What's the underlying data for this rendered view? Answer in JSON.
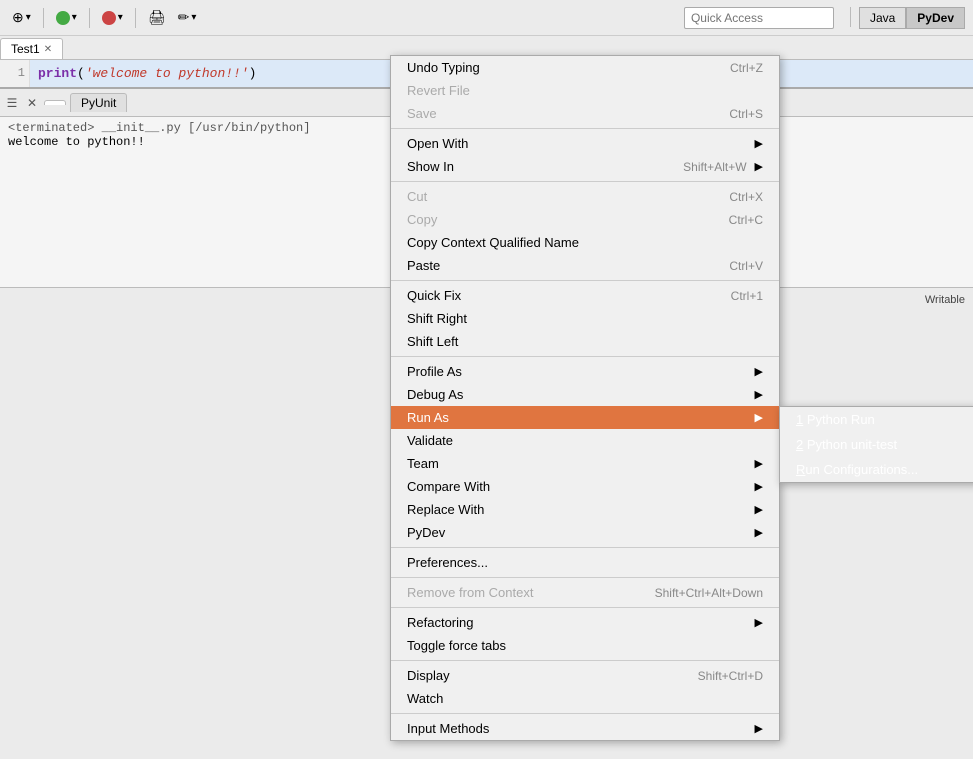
{
  "toolbar": {
    "quick_access_placeholder": "Quick Access",
    "java_label": "Java",
    "pydev_label": "PyDev"
  },
  "editor": {
    "tab_label": "Test1",
    "line1_number": "1",
    "line1_code_prefix": "print(",
    "line1_string": "'welcome to python!!'",
    "line1_code_suffix": ")"
  },
  "console": {
    "terminated_text": "<terminated> __init__.py [/usr/bin/python]",
    "output_text": "welcome to python!!",
    "tab_pyunit": "PyUnit"
  },
  "status_bar": {
    "writable": "Writable"
  },
  "context_menu": {
    "items": [
      {
        "label": "Undo Typing",
        "shortcut": "Ctrl+Z",
        "disabled": false,
        "has_arrow": false
      },
      {
        "label": "Revert File",
        "shortcut": "",
        "disabled": true,
        "has_arrow": false
      },
      {
        "label": "Save",
        "shortcut": "Ctrl+S",
        "disabled": true,
        "has_arrow": false
      },
      {
        "separator": true
      },
      {
        "label": "Open With",
        "shortcut": "",
        "disabled": false,
        "has_arrow": true
      },
      {
        "label": "Show In",
        "shortcut": "Shift+Alt+W",
        "disabled": false,
        "has_arrow": true
      },
      {
        "separator": true
      },
      {
        "label": "Cut",
        "shortcut": "Ctrl+X",
        "disabled": true,
        "has_arrow": false
      },
      {
        "label": "Copy",
        "shortcut": "Ctrl+C",
        "disabled": true,
        "has_arrow": false
      },
      {
        "label": "Copy Context Qualified Name",
        "shortcut": "",
        "disabled": false,
        "has_arrow": false
      },
      {
        "label": "Paste",
        "shortcut": "Ctrl+V",
        "disabled": false,
        "has_arrow": false
      },
      {
        "separator": true
      },
      {
        "label": "Quick Fix",
        "shortcut": "Ctrl+1",
        "disabled": false,
        "has_arrow": false
      },
      {
        "label": "Shift Right",
        "shortcut": "",
        "disabled": false,
        "has_arrow": false
      },
      {
        "label": "Shift Left",
        "shortcut": "",
        "disabled": false,
        "has_arrow": false
      },
      {
        "separator": true
      },
      {
        "label": "Profile As",
        "shortcut": "",
        "disabled": false,
        "has_arrow": true
      },
      {
        "label": "Debug As",
        "shortcut": "",
        "disabled": false,
        "has_arrow": true
      },
      {
        "label": "Run As",
        "shortcut": "",
        "disabled": false,
        "has_arrow": true,
        "highlighted": true
      },
      {
        "label": "Validate",
        "shortcut": "",
        "disabled": false,
        "has_arrow": false
      },
      {
        "label": "Team",
        "shortcut": "",
        "disabled": false,
        "has_arrow": true
      },
      {
        "label": "Compare With",
        "shortcut": "",
        "disabled": false,
        "has_arrow": true
      },
      {
        "label": "Replace With",
        "shortcut": "",
        "disabled": false,
        "has_arrow": true
      },
      {
        "label": "PyDev",
        "shortcut": "",
        "disabled": false,
        "has_arrow": true
      },
      {
        "separator": true
      },
      {
        "label": "Preferences...",
        "shortcut": "",
        "disabled": false,
        "has_arrow": false
      },
      {
        "separator": true
      },
      {
        "label": "Remove from Context",
        "shortcut": "Shift+Ctrl+Alt+Down",
        "disabled": true,
        "has_arrow": false
      },
      {
        "separator": true
      },
      {
        "label": "Refactoring",
        "shortcut": "",
        "disabled": false,
        "has_arrow": true
      },
      {
        "label": "Toggle force tabs",
        "shortcut": "",
        "disabled": false,
        "has_arrow": false
      },
      {
        "separator": true
      },
      {
        "label": "Display",
        "shortcut": "Shift+Ctrl+D",
        "disabled": false,
        "has_arrow": false
      },
      {
        "label": "Watch",
        "shortcut": "",
        "disabled": false,
        "has_arrow": false
      },
      {
        "separator": true
      },
      {
        "label": "Input Methods",
        "shortcut": "",
        "disabled": false,
        "has_arrow": true
      }
    ],
    "submenu": {
      "items": [
        {
          "label": "1 Python Run",
          "underline_index": 0
        },
        {
          "label": "2 Python unit-test",
          "underline_index": 0
        },
        {
          "label": "Run Configurations...",
          "underline_index": 0
        }
      ]
    }
  }
}
